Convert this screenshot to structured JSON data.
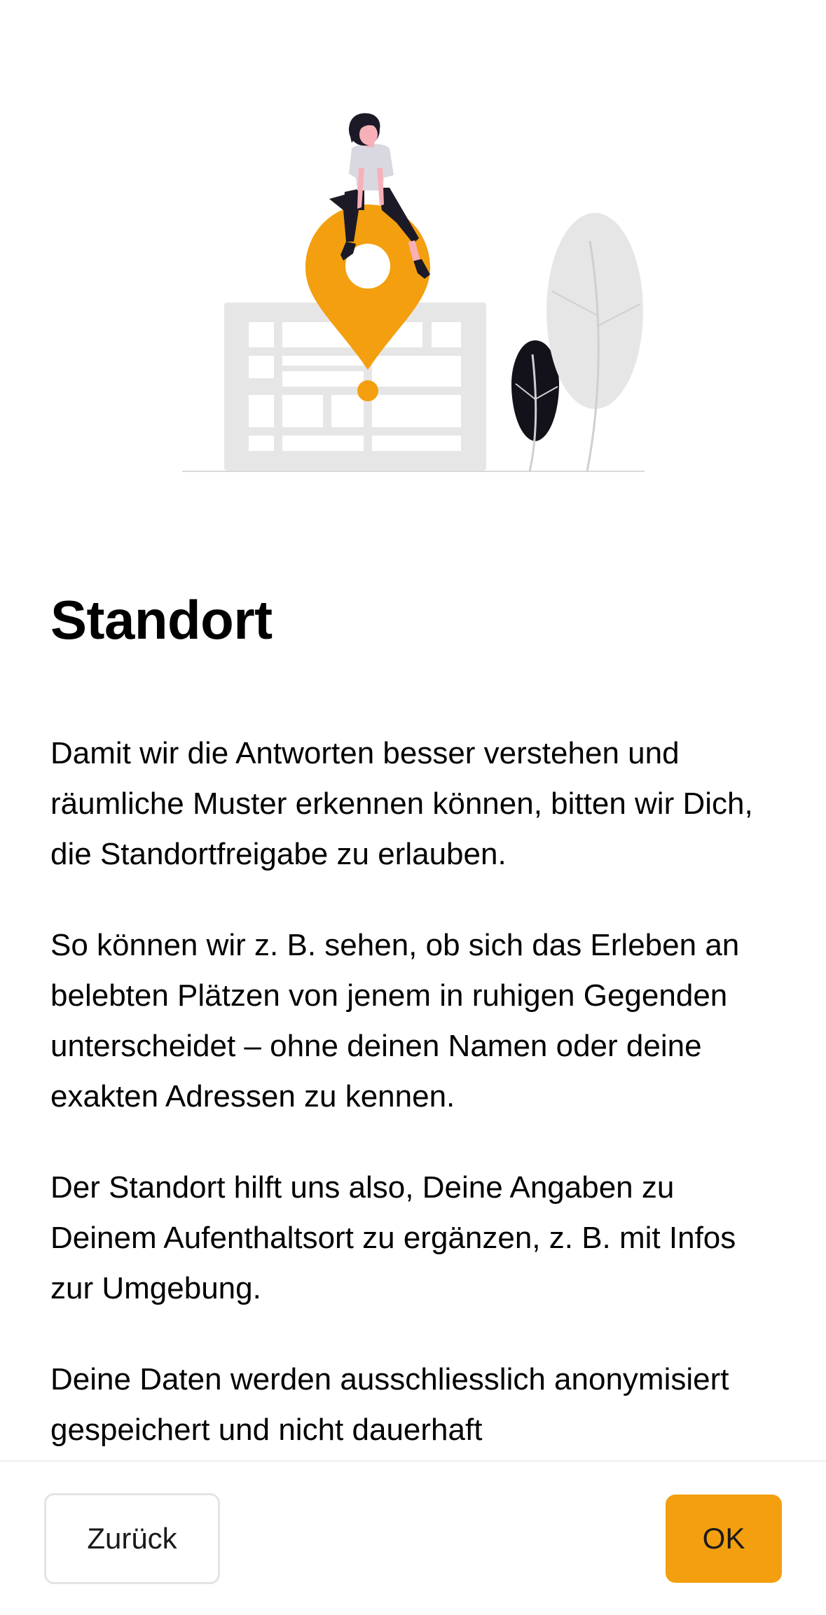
{
  "page": {
    "title": "Standort",
    "paragraphs": [
      "Damit wir die Antworten besser verstehen und räumliche Muster erkennen können, bitten wir Dich, die Standortfreigabe zu erlauben.",
      "So können wir z. B. sehen, ob sich das Erleben an belebten Plätzen von jenem in ruhigen Gegenden unterscheidet – ohne deinen Namen oder deine exakten Adressen zu kennen.",
      "Der Standort hilft uns also, Deine Angaben zu Deinem Aufenthaltsort zu ergänzen, z. B. mit Infos zur Umgebung.",
      "Deine Daten werden ausschliesslich anonymisiert gespeichert und nicht dauerhaft"
    ]
  },
  "illustration": {
    "icon": "location-pin-person-illustration",
    "accent_color": "#f39f0f"
  },
  "footer": {
    "back_label": "Zurück",
    "ok_label": "OK"
  },
  "colors": {
    "accent": "#f39f0f",
    "background": "#ffffff",
    "text": "#000000"
  }
}
